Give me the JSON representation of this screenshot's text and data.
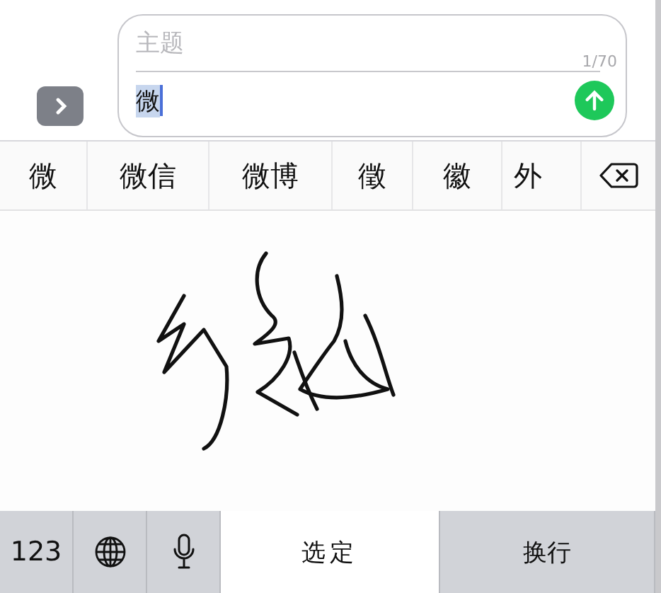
{
  "composer": {
    "subject": {
      "placeholder": "主题"
    },
    "counter": "1/70",
    "message": {
      "value": "微",
      "selected": true
    }
  },
  "candidates": [
    {
      "text": "微",
      "selected": false
    },
    {
      "text": "微信",
      "selected": false
    },
    {
      "text": "微博",
      "selected": false
    },
    {
      "text": "徵",
      "selected": false
    },
    {
      "text": "徽",
      "selected": false
    },
    {
      "text": "外",
      "selected": false
    }
  ],
  "keys": [
    {
      "kind": "text",
      "label": "123"
    },
    {
      "kind": "globe"
    },
    {
      "kind": "mic"
    },
    {
      "kind": "select",
      "label": "选定"
    },
    {
      "kind": "return",
      "label": "换行"
    }
  ]
}
